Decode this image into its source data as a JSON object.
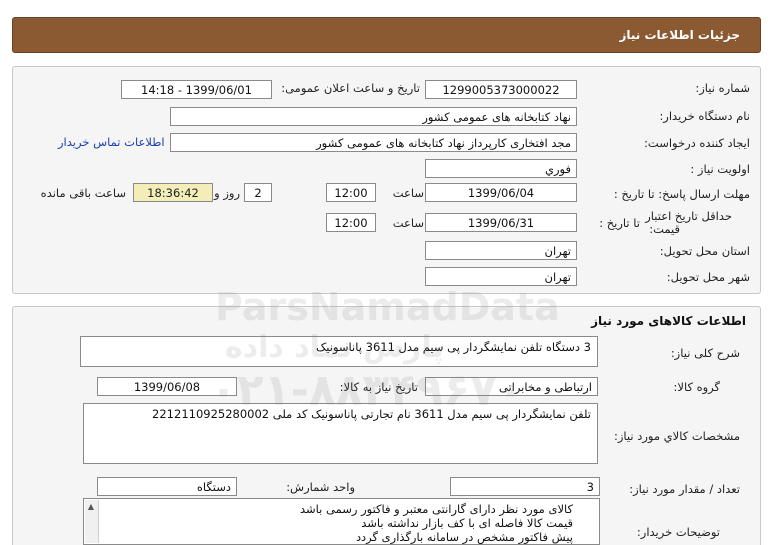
{
  "header": {
    "title": "جزئیات اطلاعات نیاز"
  },
  "info": {
    "need_number_label": "شماره نیاز:",
    "need_number": "1299005373000022",
    "announce_label": "تاریخ و ساعت اعلان عمومی:",
    "announce_value": "1399/06/01 - 14:18",
    "buyer_org_label": "نام دستگاه خریدار:",
    "buyer_org": "نهاد کتابخانه های عمومی کشور",
    "creator_label": "ایجاد کننده درخواست:",
    "creator": "مجد افتخاری کارپرداز نهاد کتابخانه های عمومی کشور",
    "contact_link": "اطلاعات تماس خریدار",
    "priority_label": "اولویت نیاز :",
    "priority": "فوري",
    "deadline_label": "مهلت ارسال پاسخ:  تا تاریخ :",
    "deadline_date": "1399/06/04",
    "time_label": "ساعت",
    "deadline_time": "12:00",
    "days_value": "2",
    "days_label": "روز و",
    "remaining_time": "18:36:42",
    "remaining_label": "ساعت باقی مانده",
    "validity_label_1": "حداقل تاریخ اعتبار",
    "validity_label_2": "قیمت:",
    "validity_to_label": "تا تاریخ :",
    "validity_date": "1399/06/31",
    "validity_time_label": "ساعت",
    "validity_time": "12:00",
    "province_label": "استان محل تحویل:",
    "province": "تهران",
    "city_label": "شهر محل تحویل:",
    "city": "تهران"
  },
  "goods": {
    "section_title": "اطلاعات کالاهای مورد نیاز",
    "summary_label": "شرح کلی نیاز:",
    "summary": "3 دستگاه تلفن نمایشگردار پی سیم مدل 3611 پاناسونیک",
    "group_label": "گروه کالا:",
    "group": "ارتباطی و مخابراتی",
    "need_date_label": "تاریخ نیاز به کالا:",
    "need_date": "1399/06/08",
    "specs_label": "مشخصات کالاي مورد نياز:",
    "specs": "تلفن نمایشگردار پی سیم مدل 3611 نام تجارتی پاناسونیک کد ملی 2212110925280002",
    "quantity_label": "تعداد / مقدار مورد نیاز:",
    "quantity": "3",
    "unit_label": "واحد شمارش:",
    "unit": "دستگاه",
    "buyer_notes_label": "توضیحات خریدار:",
    "buyer_notes": [
      "کالای مورد نظر دارای گارانتی معتبر و فاکتور رسمی باشد",
      "قیمت کالا فاصله ای با کف بازار نداشته باشد",
      "پیش فاکتور مشخص در سامانه بارگذاری گردد"
    ]
  },
  "watermark": {
    "line1": "ParsNamadData",
    "line2": "پارس نماد داده",
    "line3": "۰۲۱-۸۸۳۴۹۶۷۰"
  },
  "colors": {
    "header": "#8b5a33",
    "panel": "#f5f5f5",
    "link": "#1a3fb0",
    "highlight": "#f3eeb8"
  }
}
